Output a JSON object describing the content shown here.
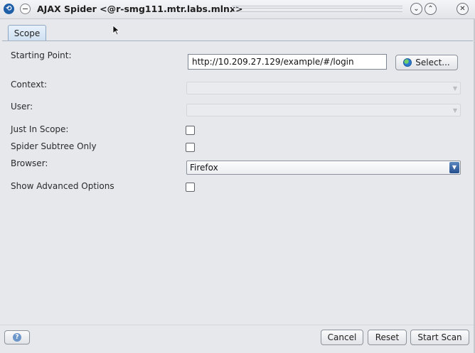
{
  "window": {
    "title": "AJAX Spider <@r-smg111.mtr.labs.mlnx>",
    "app_icon": "zap-icon",
    "app_icon_glyph": "⟲",
    "controls": {
      "minimize": "⌄",
      "maximize": "⌃",
      "close": "✕"
    }
  },
  "tabs": [
    {
      "label": "Scope",
      "selected": true
    }
  ],
  "form": {
    "starting_point": {
      "label": "Starting Point:",
      "value": "http://10.209.27.129/example/#/login"
    },
    "select_button": {
      "label": "Select...",
      "icon": "globe-icon"
    },
    "context": {
      "label": "Context:",
      "value": "",
      "enabled": false
    },
    "user": {
      "label": "User:",
      "value": "",
      "enabled": false
    },
    "just_in_scope": {
      "label": "Just In Scope:",
      "checked": false
    },
    "spider_subtree_only": {
      "label": "Spider Subtree Only",
      "checked": false
    },
    "browser": {
      "label": "Browser:",
      "value": "Firefox"
    },
    "show_advanced": {
      "label": "Show Advanced Options",
      "checked": false
    }
  },
  "footer": {
    "help_icon": "help-icon",
    "help_glyph": "?",
    "cancel_label": "Cancel",
    "reset_label": "Reset",
    "start_label": "Start Scan"
  },
  "colors": {
    "accent": "#234f8e",
    "tab_bg": "#cfe0f1",
    "window_bg": "#e6e8ec"
  }
}
